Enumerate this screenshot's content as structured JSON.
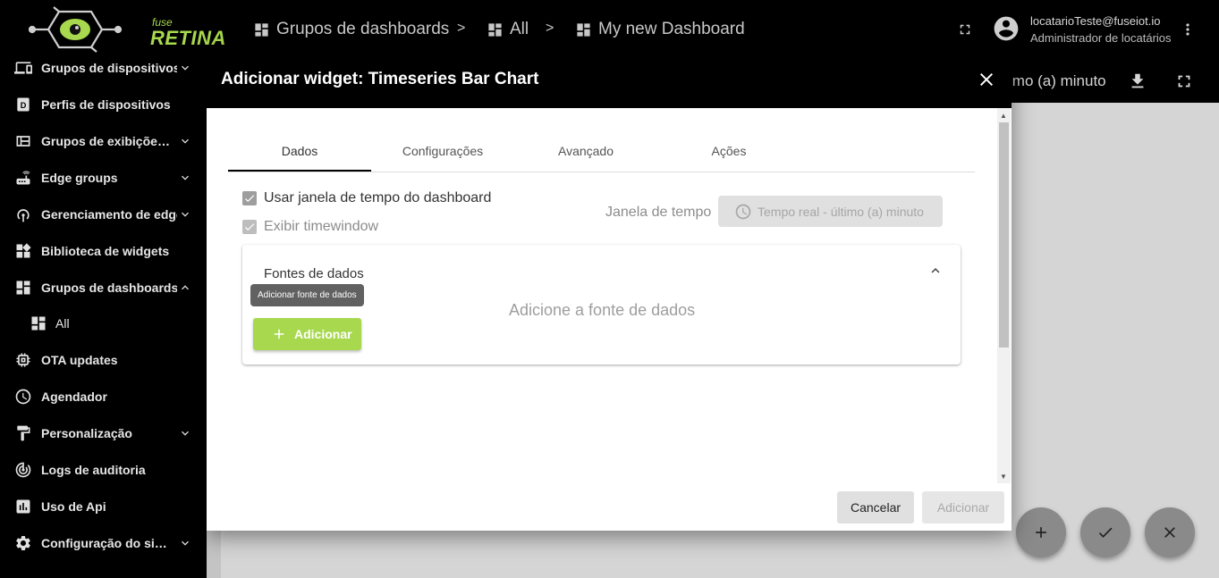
{
  "app": {
    "logo_fuse": "fuse",
    "logo_retina": "RETINA",
    "brand_color": "#a7d84e"
  },
  "breadcrumb": {
    "items": [
      "Grupos de dashboards",
      "All",
      "My new Dashboard"
    ],
    "separator": ">"
  },
  "user": {
    "email": "locatarioTeste@fuseiot.io",
    "role": "Administrador de locatários"
  },
  "sidebar": {
    "items": [
      {
        "label": "Grupos de dispositivos",
        "icon": "devices-icon",
        "expandable": true
      },
      {
        "label": "Perfis de dispositivos",
        "icon": "device-profile-icon",
        "expandable": false
      },
      {
        "label": "Grupos de exibições de entidade",
        "icon": "entity-view-icon",
        "expandable": true
      },
      {
        "label": "Edge groups",
        "icon": "router-icon",
        "expandable": true
      },
      {
        "label": "Gerenciamento de edge",
        "icon": "wifi-tethering-icon",
        "expandable": true
      },
      {
        "label": "Biblioteca de widgets",
        "icon": "widgets-icon",
        "expandable": false
      },
      {
        "label": "Grupos de dashboards",
        "icon": "dashboard-icon",
        "expandable": true,
        "expanded": true
      },
      {
        "label": "All",
        "icon": "dashboard-icon",
        "sub": true
      },
      {
        "label": "OTA updates",
        "icon": "memory-icon",
        "expandable": false
      },
      {
        "label": "Agendador",
        "icon": "schedule-icon",
        "expandable": false
      },
      {
        "label": "Personalização",
        "icon": "format-paint-icon",
        "expandable": true
      },
      {
        "label": "Logs de auditoria",
        "icon": "track-changes-icon",
        "expandable": false
      },
      {
        "label": "Uso de Api",
        "icon": "insert-chart-icon",
        "expandable": false
      },
      {
        "label": "Configuração do sistema",
        "icon": "settings-icon",
        "expandable": true
      }
    ]
  },
  "dashboard": {
    "timewindow_partial": "imo (a) minuto"
  },
  "dialog": {
    "title": "Adicionar widget: Timeseries Bar Chart",
    "tabs": [
      "Dados",
      "Configurações",
      "Avançado",
      "Ações"
    ],
    "active_tab": "Dados",
    "use_dashboard_timewindow": {
      "label": "Usar janela de tempo do dashboard",
      "checked": true
    },
    "display_timewindow": {
      "label": "Exibir timewindow",
      "checked": true
    },
    "timewindow_label": "Janela de tempo",
    "timewindow_value": "Tempo real - último (a) minuto",
    "datasources": {
      "title": "Fontes de dados",
      "tooltip": "Adicionar fonte de dados",
      "add_label": "Adicionar",
      "empty_text": "Adicione a fonte de dados"
    },
    "cancel_label": "Cancelar",
    "add_label": "Adicionar"
  }
}
